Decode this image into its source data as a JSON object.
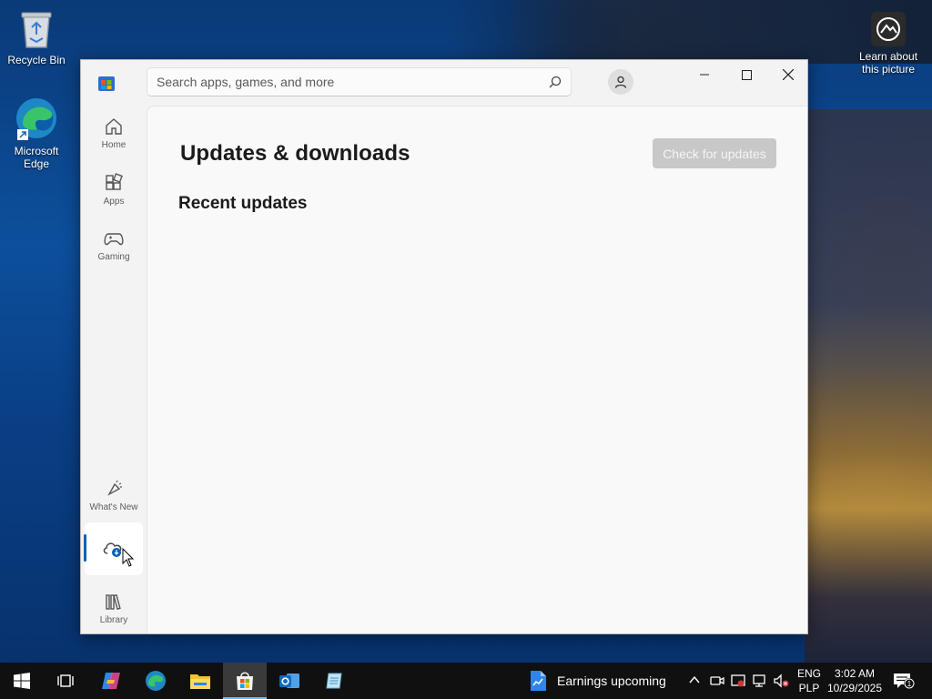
{
  "desktop": {
    "icons": [
      {
        "label": "Recycle Bin"
      },
      {
        "label": "Microsoft Edge"
      },
      {
        "label": "Learn about this picture"
      }
    ]
  },
  "window": {
    "search": {
      "placeholder": "Search apps, games, and more"
    },
    "page_title": "Updates & downloads",
    "section_title": "Recent updates",
    "check_button": "Check for updates",
    "sidebar": {
      "items": [
        {
          "label": "Home"
        },
        {
          "label": "Apps"
        },
        {
          "label": "Gaming"
        },
        {
          "label": "What's New"
        },
        {
          "label": ""
        },
        {
          "label": "Library"
        }
      ]
    }
  },
  "taskbar": {
    "news": "Earnings upcoming",
    "language": {
      "line1": "ENG",
      "line2": "PLP"
    },
    "clock": {
      "time": "3:02 AM",
      "date": "10/29/2025"
    },
    "notification_count": "1"
  },
  "colors": {
    "accent": "#005fb8",
    "taskbar": "#101010",
    "disabled_button": "#c8c8c8"
  }
}
